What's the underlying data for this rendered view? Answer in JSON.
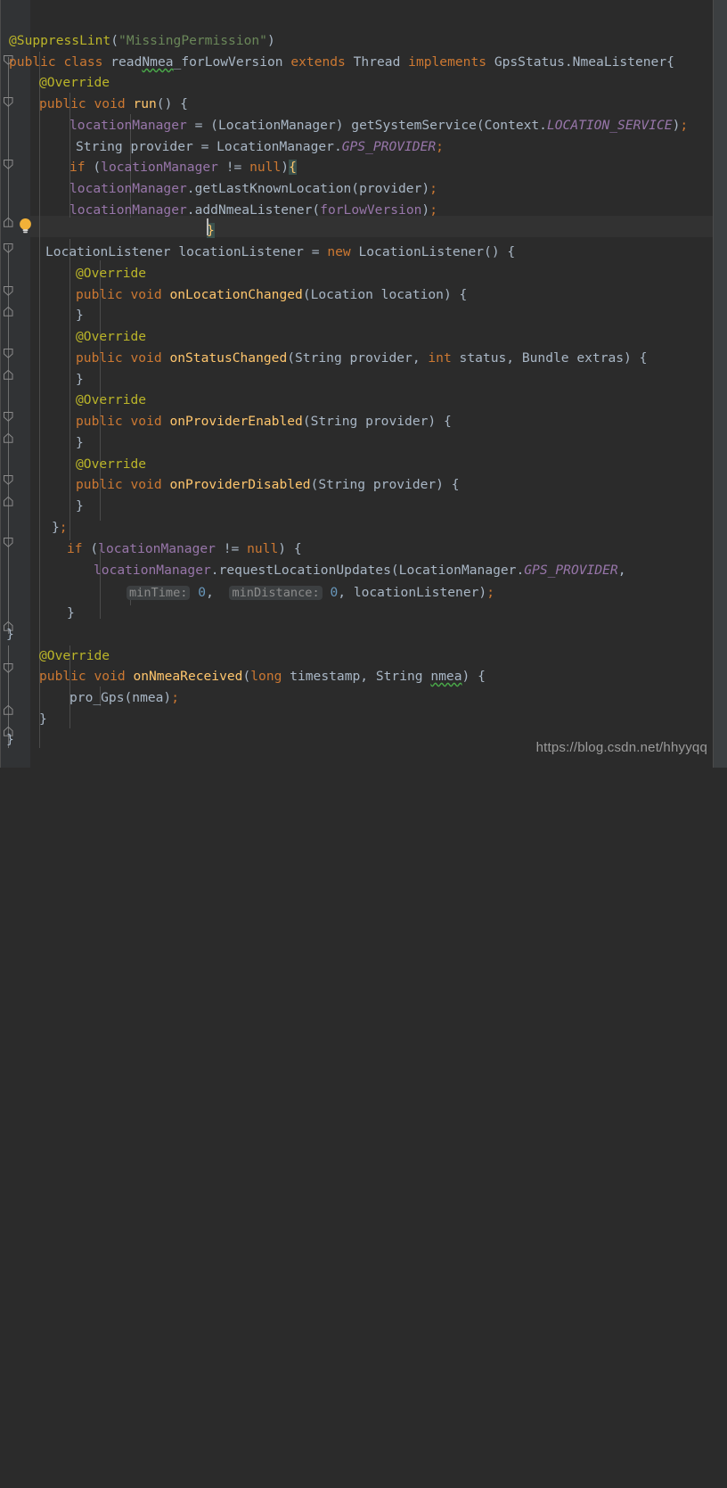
{
  "editor": {
    "theme": "darcula",
    "background": "#2b2b2b",
    "gutter_background": "#313335",
    "current_line_background": "#323232",
    "default_text_color": "#a9b7c6",
    "language": "java",
    "font_size_px": 14.6,
    "line_height_px": 23.5,
    "current_line_index": 9,
    "caret": {
      "line": 9,
      "column": 29
    }
  },
  "colors": {
    "keyword": "#cc7832",
    "annotation": "#bbb529",
    "string": "#6a8759",
    "field": "#9876aa",
    "static_field": "#9876aa",
    "number": "#6897bb",
    "method_declaration": "#ffc66d",
    "identifier": "#a9b7c6",
    "brace_match_bg": "#3b514d",
    "typo_squiggle": "#49a849",
    "param_hint_bg": "#3c3f41",
    "param_hint_fg": "#8c8c8c",
    "bulb": "#f2b138"
  },
  "gutter": {
    "fold_markers": [
      {
        "line": 1,
        "type": "fold-collapse"
      },
      {
        "line": 3,
        "type": "fold-collapse"
      },
      {
        "line": 6,
        "type": "fold-collapse"
      },
      {
        "line": 10,
        "type": "fold-collapse"
      },
      {
        "line": 11,
        "type": "fold-collapse"
      },
      {
        "line": 13,
        "type": "fold-collapse"
      },
      {
        "line": 16,
        "type": "fold-collapse"
      },
      {
        "line": 19,
        "type": "fold-collapse"
      },
      {
        "line": 22,
        "type": "fold-collapse"
      },
      {
        "line": 26,
        "type": "fold-collapse"
      },
      {
        "line": 28,
        "type": "fold-collapse"
      },
      {
        "line": 31,
        "type": "fold-collapse"
      },
      {
        "line": 32,
        "type": "fold-collapse"
      },
      {
        "line": 34,
        "type": "fold-collapse"
      }
    ],
    "intention_bulb": {
      "line": 9,
      "icon": "lightbulb-icon",
      "tooltip": "Show intention actions"
    }
  },
  "code": {
    "lines": [
      "@SuppressLint(\"MissingPermission\")",
      "public class readNmea_forLowVersion extends Thread implements GpsStatus.NmeaListener{",
      "    @Override",
      "    public void run() {",
      "        locationManager = (LocationManager) getSystemService(Context.LOCATION_SERVICE);",
      "        String provider = LocationManager.GPS_PROVIDER;",
      "        if (locationManager != null){",
      "        locationManager.getLastKnownLocation(provider);",
      "        locationManager.addNmeaListener(forLowVersion);",
      "                        }",
      "    LocationListener locationListener = new LocationListener() {",
      "        @Override",
      "        public void onLocationChanged(Location location) {",
      "        }",
      "        @Override",
      "        public void onStatusChanged(String provider, int status, Bundle extras) {",
      "        }",
      "        @Override",
      "        public void onProviderEnabled(String provider) {",
      "        }",
      "        @Override",
      "        public void onProviderDisabled(String provider) {",
      "        }",
      "    };",
      "      if (locationManager != null) {",
      "          locationManager.requestLocationUpdates(LocationManager.GPS_PROVIDER,",
      "              minTime: 0,  minDistance: 0, locationListener);",
      "      }",
      "}",
      "    @Override",
      "    public void onNmeaReceived(long timestamp, String nmea) {",
      "        pro_Gps(nmea);",
      "    }",
      "}"
    ],
    "parameter_hints": [
      {
        "label": "minTime:",
        "value": "0"
      },
      {
        "label": "minDistance:",
        "value": "0"
      }
    ],
    "typos": [
      "Nmea",
      "nmea"
    ],
    "matched_braces": [
      "{",
      "}"
    ]
  },
  "watermark": {
    "text": "https://blog.csdn.net/hhyyqq"
  }
}
